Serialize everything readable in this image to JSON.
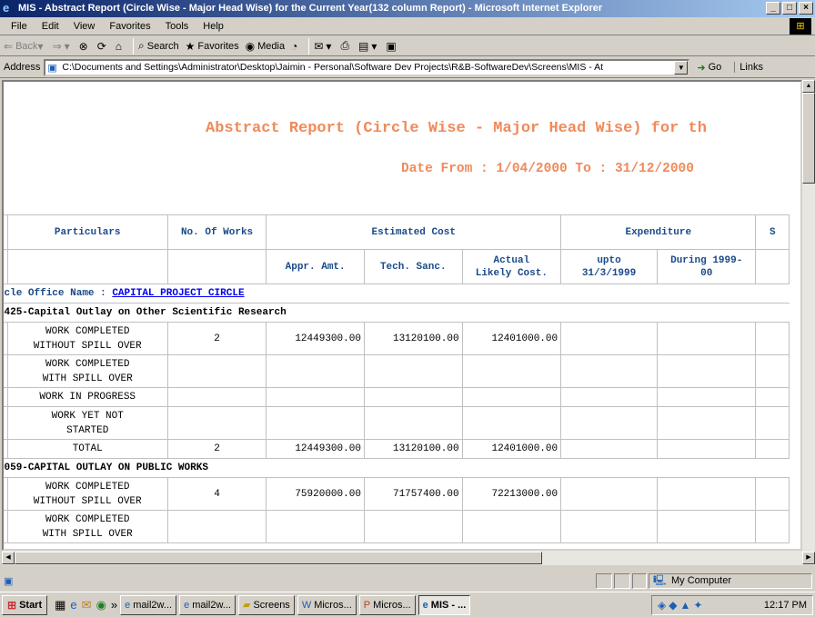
{
  "window": {
    "title": "MIS - Abstract Report (Circle Wise - Major Head Wise) for the Current Year(132 column Report) - Microsoft Internet Explorer",
    "min": "_",
    "max": "□",
    "close": "×"
  },
  "menu": [
    "File",
    "Edit",
    "View",
    "Favorites",
    "Tools",
    "Help"
  ],
  "toolbar": {
    "back": "Back",
    "search": "Search",
    "favorites": "Favorites",
    "media": "Media"
  },
  "address": {
    "label": "Address",
    "value": "C:\\Documents and Settings\\Administrator\\Desktop\\Jaimin - Personal\\Software Dev Projects\\R&B-SoftwareDev\\Screens\\MIS - At",
    "go": "Go",
    "links": "Links"
  },
  "report": {
    "title": "Abstract Report (Circle Wise - Major Head Wise) for th",
    "date_range": "Date From : 1/04/2000 To : 31/12/2000",
    "headers": {
      "particulars": "Particulars",
      "no_of_works": "No. Of Works",
      "estimated_cost": "Estimated Cost",
      "expenditure": "Expenditure",
      "next_cut": "S",
      "appr_amt": "Appr. Amt.",
      "tech_sanc": "Tech. Sanc.",
      "actual_likely_1": "Actual",
      "actual_likely_2": "Likely Cost.",
      "upto_1": "upto",
      "upto_2": "31/3/1999",
      "during_1": "During 1999-",
      "during_2": "00"
    },
    "circle_label": "cle Office Name : ",
    "circle_name": "CAPITAL PROJECT CIRCLE",
    "sections": [
      {
        "head": "425-Capital Outlay on Other Scientific Research",
        "rows": [
          {
            "p1": "WORK COMPLETED",
            "p2": "WITHOUT SPILL OVER",
            "works": "2",
            "appr": "12449300.00",
            "tech": "13120100.00",
            "actual": "12401000.00"
          },
          {
            "p1": "WORK COMPLETED",
            "p2": "WITH SPILL OVER",
            "works": "",
            "appr": "",
            "tech": "",
            "actual": ""
          },
          {
            "p1": "WORK IN PROGRESS",
            "p2": "",
            "works": "",
            "appr": "",
            "tech": "",
            "actual": ""
          },
          {
            "p1": "WORK YET NOT",
            "p2": "STARTED",
            "works": "",
            "appr": "",
            "tech": "",
            "actual": ""
          },
          {
            "p1": "TOTAL",
            "p2": "",
            "works": "2",
            "appr": "12449300.00",
            "tech": "13120100.00",
            "actual": "12401000.00"
          }
        ]
      },
      {
        "head": "059-CAPITAL OUTLAY ON PUBLIC WORKS",
        "rows": [
          {
            "p1": "WORK COMPLETED",
            "p2": "WITHOUT SPILL OVER",
            "works": "4",
            "appr": "75920000.00",
            "tech": "71757400.00",
            "actual": "72213000.00"
          },
          {
            "p1": "WORK COMPLETED",
            "p2": "WITH SPILL OVER",
            "works": "",
            "appr": "",
            "tech": "",
            "actual": ""
          }
        ]
      }
    ]
  },
  "status": {
    "zone": "My Computer"
  },
  "taskbar": {
    "start": "Start",
    "more": "»",
    "tasks": [
      "mail2w...",
      "mail2w...",
      "Screens",
      "Micros...",
      "Micros...",
      "MIS - ..."
    ],
    "clock": "12:17 PM"
  }
}
